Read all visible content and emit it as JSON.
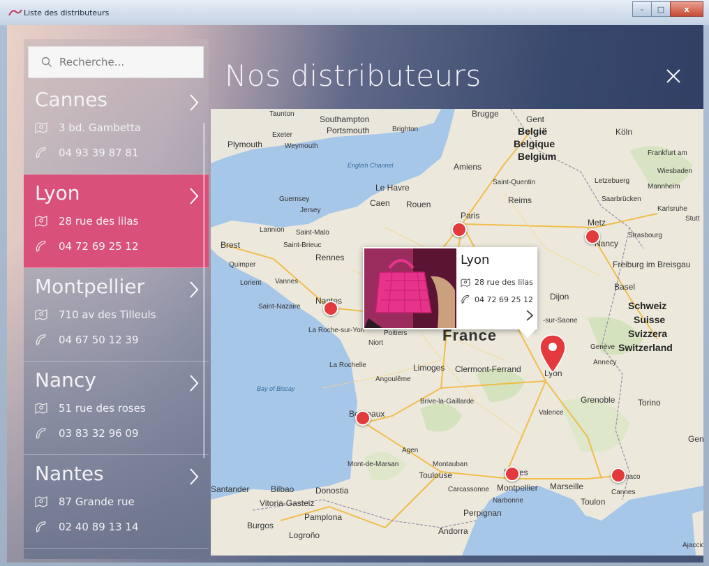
{
  "window": {
    "title": "Liste des distributeurs",
    "controls": {
      "minimize": "–",
      "maximize": "□",
      "close": "x"
    }
  },
  "header": {
    "title": "Nos distributeurs"
  },
  "search": {
    "placeholder": "Recherche..."
  },
  "distributors": [
    {
      "city": "Cannes",
      "address": "3 bd. Gambetta",
      "phone": "04 93 39 87 81"
    },
    {
      "city": "Lyon",
      "address": "28 rue des lilas",
      "phone": "04 72 69 25 12"
    },
    {
      "city": "Montpellier",
      "address": "710 av des Tilleuls",
      "phone": "04 67 50 12 39"
    },
    {
      "city": "Nancy",
      "address": "51 rue des roses",
      "phone": "03 83 32 96 09"
    },
    {
      "city": "Nantes",
      "address": "87 Grande rue",
      "phone": "02 40 89 13 14"
    }
  ],
  "selected_index": 1,
  "popup": {
    "city": "Lyon",
    "address": "28 rue des lilas",
    "phone": "04 72 69 25 12"
  },
  "colors": {
    "accent": "#d9507a",
    "marker": "#e23a3d"
  },
  "map": {
    "labels": {
      "southampton": "Southampton",
      "brighton": "Brighton",
      "portsmouth": "Portsmouth",
      "plymouth": "Plymouth",
      "exeter": "Exeter",
      "weymouth": "Weymouth",
      "taunton": "Taunton",
      "english_channel": "English Channel",
      "brugge": "Brugge",
      "gent": "Gent",
      "belgie": "België",
      "belgique": "Belgique",
      "belgium": "Belgium",
      "koln": "Köln",
      "frankfurt": "Frankfurt am",
      "wiesbaden": "Wiesbaden",
      "mannheim": "Mannheim",
      "karlsruhe": "Karlsruhe",
      "stuttgart": "Stutt",
      "luxembourg": "Letzebuerg",
      "saarbrucken": "Saarbrücken",
      "amiens": "Amiens",
      "saint_quentin": "Saint-Quentin",
      "le_havre": "Le Havre",
      "caen": "Caen",
      "rouen": "Rouen",
      "reims": "Reims",
      "paris": "Paris",
      "metz": "Metz",
      "nancy": "Nancy",
      "strasbourg": "Strasbourg",
      "freiburg": "Freiburg im Breisgau",
      "basel": "Basel",
      "guernsey": "Guernsey",
      "jersey": "Jersey",
      "brest": "Brest",
      "lannion": "Lannion",
      "saint_malo": "Saint-Malo",
      "saint_brieuc": "Saint-Brieuc",
      "quimper": "Quimper",
      "rennes": "Rennes",
      "lorient": "Lorient",
      "vannes": "Vannes",
      "saint_nazaire": "Saint-Nazaire",
      "nantes": "Nantes",
      "dijon": "Dijon",
      "chalon": "-sur-Saone",
      "schweiz": "Schweiz",
      "suisse": "Suisse",
      "svizzera": "Svizzera",
      "switzerland": "Switzerland",
      "geneve": "Genève",
      "annecy": "Annecy",
      "france": "France",
      "niort": "Niort",
      "poitiers": "Poitiers",
      "la_roche": "La Roche-sur-Yon",
      "la_rochelle": "La Rochelle",
      "limoges": "Limoges",
      "clermont": "Clermont-Ferrand",
      "lyon": "Lyon",
      "angouleme": "Angoulême",
      "grenoble": "Grenoble",
      "torino": "Torino",
      "bay_biscay": "Bay of Biscay",
      "brive": "Brive-la-Gaillarde",
      "bordeaux": "Bordeaux",
      "valence": "Valence",
      "genova": "Genov",
      "agen": "Agen",
      "mont_marsan": "Mont-de-Marsan",
      "montauban": "Montauban",
      "toulouse": "Toulouse",
      "nimes": "Nîmes",
      "montpellier": "Montpellier",
      "marseille": "Marseille",
      "toulon": "Toulon",
      "monaco": "Monaco",
      "cannes": "Cannes",
      "santander": "Santander",
      "bilbao": "Bilbao",
      "donostia": "Donostia",
      "vitoria": "Vitoria-Gasteiz",
      "pamplona": "Pamplona",
      "carcassonne": "Carcassonne",
      "narbonne": "Narbonne",
      "perpignan": "Perpignan",
      "burgos": "Burgos",
      "logrono": "Logroño",
      "andorra": "Andorra",
      "ajaccio": "Ajaccio"
    }
  }
}
